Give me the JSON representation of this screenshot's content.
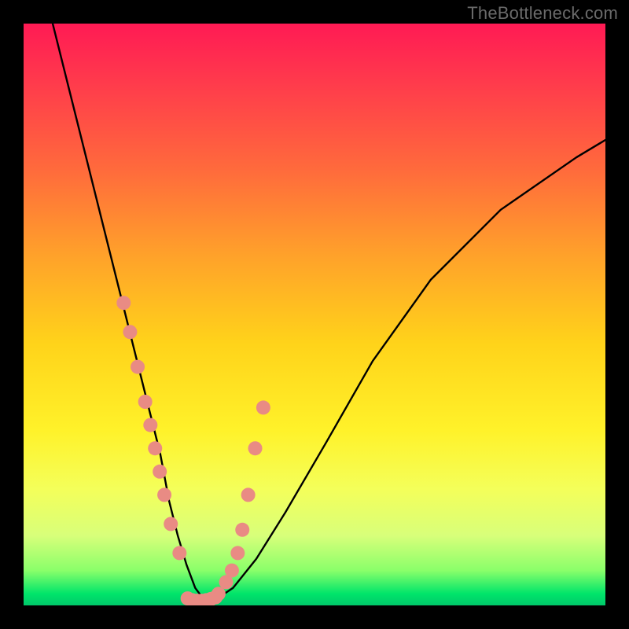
{
  "watermark": "TheBottleneck.com",
  "chart_data": {
    "type": "line",
    "title": "",
    "xlabel": "",
    "ylabel": "",
    "xlim": [
      0,
      100
    ],
    "ylim": [
      0,
      100
    ],
    "grid": false,
    "legend": false,
    "series": [
      {
        "name": "bottleneck-curve",
        "color": "#000000",
        "x": [
          5,
          8,
          11,
          14,
          17,
          19.5,
          21.5,
          23.5,
          25,
          26.5,
          28,
          29.5,
          31,
          33,
          36,
          40,
          45,
          52,
          60,
          70,
          82,
          95,
          100
        ],
        "y": [
          100,
          88,
          76,
          64,
          52,
          42,
          34,
          26,
          18,
          12,
          7,
          3,
          1,
          1,
          3,
          8,
          16,
          28,
          42,
          56,
          68,
          77,
          80
        ]
      }
    ],
    "markers": [
      {
        "name": "highlight-dots-left",
        "color": "#e98b84",
        "x": [
          17.2,
          18.3,
          19.6,
          20.9,
          21.8,
          22.6,
          23.4,
          24.2,
          25.3,
          26.8
        ],
        "y": [
          52,
          47,
          41,
          35,
          31,
          27,
          23,
          19,
          14,
          9
        ]
      },
      {
        "name": "highlight-dots-right",
        "color": "#e98b84",
        "x": [
          33.5,
          34.8,
          35.8,
          36.8,
          37.6,
          38.6,
          39.8,
          41.2
        ],
        "y": [
          2,
          4,
          6,
          9,
          13,
          19,
          27,
          34
        ]
      },
      {
        "name": "highlight-dots-bottom",
        "color": "#e98b84",
        "x": [
          28.2,
          29.0,
          29.8,
          30.6,
          31.4,
          32.2,
          33.0
        ],
        "y": [
          1.2,
          0.9,
          0.8,
          0.8,
          0.9,
          1.1,
          1.4
        ]
      }
    ]
  }
}
